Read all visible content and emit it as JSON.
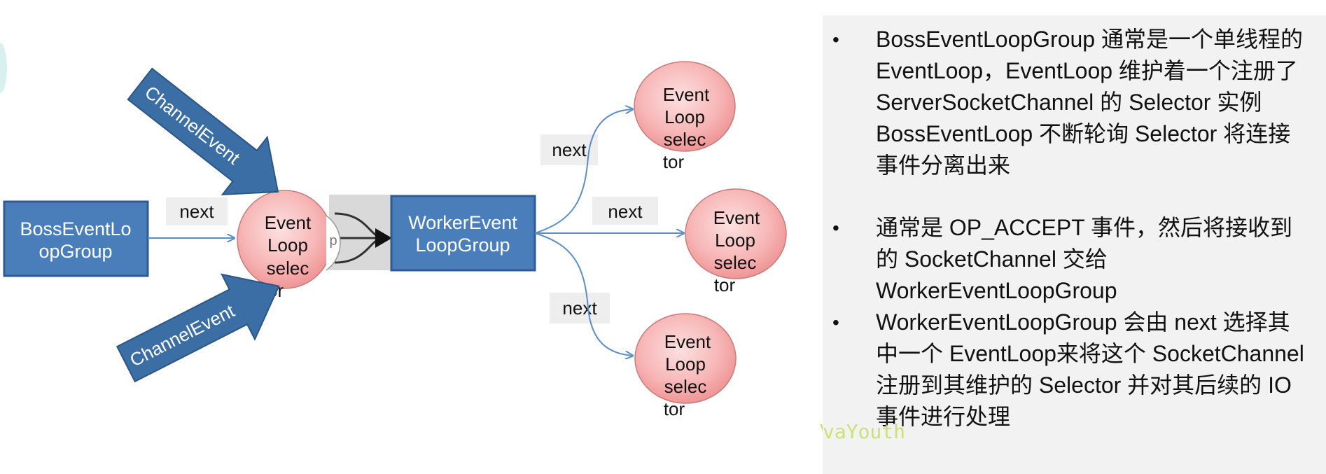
{
  "boss_group": {
    "label_lines": [
      "BossEventLo",
      "opGroup"
    ]
  },
  "worker_group": {
    "label_lines": [
      "WorkerEvent",
      "LoopGroup"
    ]
  },
  "boss_loop": {
    "label_lines": [
      "Event",
      "Loop",
      "selec",
      "tor"
    ]
  },
  "worker_loops": [
    {
      "label_lines": [
        "Event",
        "Loop",
        "selec",
        "tor"
      ]
    },
    {
      "label_lines": [
        "Event",
        "Loop",
        "selec",
        "tor"
      ]
    },
    {
      "label_lines": [
        "Event",
        "Loop",
        "selec",
        "tor"
      ]
    }
  ],
  "edge_labels": {
    "boss_next": "next",
    "worker_next_top": "next",
    "worker_next_mid": "next",
    "worker_next_bottom": "next"
  },
  "channel_event_top": "ChannelEvent",
  "channel_event_bottom": "ChannelEvent",
  "connector_fragment": "p",
  "watermark": "vaYouth",
  "colors": {
    "box_fill": "#4a7ebb",
    "box_border": "#2e5b94",
    "node_fill": "#f4a9a9",
    "edge": "#5b8ec8"
  },
  "notes": [
    "BossEventLoopGroup 通常是一个单线程的 EventLoop，EventLoop 维护着一个注册了ServerSocketChannel 的 Selector 实例BossEventLoop 不断轮询 Selector 将连接事件分离出来",
    "通常是 OP_ACCEPT 事件，然后将接收到的 SocketChannel 交给 WorkerEventLoopGroup",
    "WorkerEventLoopGroup 会由 next 选择其中一个 EventLoop来将这个 SocketChannel 注册到其维护的 Selector 并对其后续的 IO 事件进行处理"
  ]
}
